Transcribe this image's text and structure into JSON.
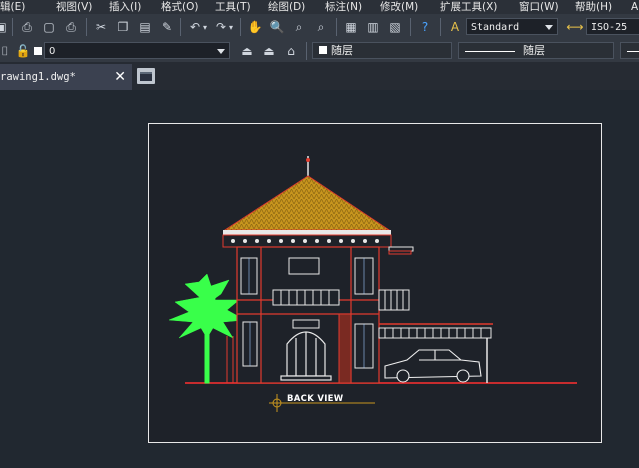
{
  "menu": {
    "items": [
      "辑(E)",
      "视图(V)",
      "插入(I)",
      "格式(O)",
      "工具(T)",
      "绘图(D)",
      "标注(N)",
      "修改(M)",
      "扩展工具(X)",
      "窗口(W)",
      "帮助(H)",
      "A"
    ]
  },
  "toolbar": {
    "text_style": "Standard",
    "dim_style": "ISO-25"
  },
  "layer_bar": {
    "layer_name": "0",
    "color": "随层",
    "linetype": "随层"
  },
  "tabs": {
    "document_title": "rawing1.dwg*",
    "close_symbol": "✕"
  },
  "drawing": {
    "caption": "BACK VIEW"
  },
  "colors": {
    "menu_bg": "#2b3038",
    "toolbar_bg": "#333942",
    "canvas_bg": "#212830",
    "sheet_border": "#e8e8e8",
    "roof": "#c8961e",
    "wall_red": "#e23b2e",
    "palm": "#39ff4a",
    "car": "#f0f0f0",
    "ground": "#ff3030"
  }
}
